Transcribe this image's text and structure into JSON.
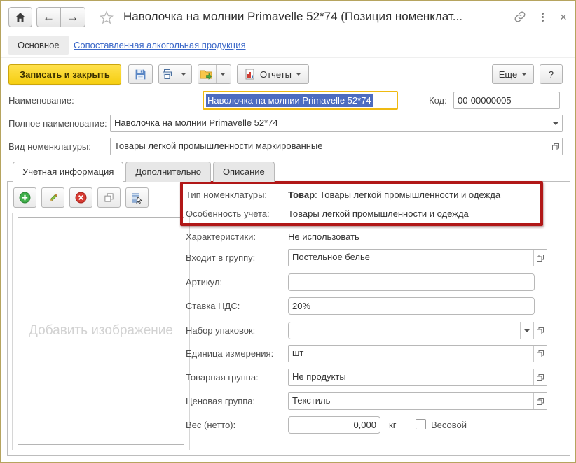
{
  "window": {
    "title": "Наволочка на молнии Primavelle 52*74 (Позиция номенклат...",
    "nav": {
      "main_tab": "Основное",
      "link_tab": "Сопоставленная алкогольная продукция"
    }
  },
  "toolbar": {
    "save_close_label": "Записать и закрыть",
    "reports_label": "Отчеты",
    "more_label": "Еще",
    "help_label": "?"
  },
  "header_fields": {
    "name_label": "Наименование:",
    "name_value": "Наволочка на молнии Primavelle 52*74",
    "code_label": "Код:",
    "code_value": "00-00000005",
    "full_name_label": "Полное наименование:",
    "full_name_value": "Наволочка на молнии Primavelle 52*74",
    "kind_label": "Вид номенклатуры:",
    "kind_value": "Товары легкой промышленности маркированные"
  },
  "tabs": {
    "t1": "Учетная информация",
    "t2": "Дополнительно",
    "t3": "Описание"
  },
  "image_panel": {
    "placeholder": "Добавить изображение"
  },
  "details": {
    "type_label": "Тип номенклатуры:",
    "type_value_bold": "Товар",
    "type_value_rest": ": Товары легкой промышленности и одежда",
    "accounting_label": "Особенность учета:",
    "accounting_value": "Товары легкой промышленности и одежда",
    "characteristics_label": "Характеристики:",
    "characteristics_value": "Не использовать",
    "group_label": "Входит в группу:",
    "group_value": "Постельное белье",
    "article_label": "Артикул:",
    "article_value": "",
    "vat_label": "Ставка НДС:",
    "vat_value": "20%",
    "packaging_label": "Набор упаковок:",
    "packaging_value": "",
    "unit_label": "Единица измерения:",
    "unit_value": "шт",
    "product_group_label": "Товарная группа:",
    "product_group_value": "Не продукты",
    "price_group_label": "Ценовая группа:",
    "price_group_value": "Текстиль",
    "weight_label": "Вес (нетто):",
    "weight_value": "0,000",
    "weight_unit": "кг",
    "weighted_label": "Весовой"
  },
  "icons": {
    "titlebar": [
      "home-icon",
      "back-icon",
      "forward-icon",
      "favorite-star-icon",
      "copy-link-icon",
      "more-kebab-icon",
      "close-icon"
    ],
    "command_bar": [
      "save-icon",
      "print-icon",
      "attach-folder-icon",
      "report-icon"
    ],
    "list_toolbar": [
      "add-icon",
      "edit-pencil-icon",
      "delete-icon",
      "copy-icon",
      "pick-from-list-icon"
    ],
    "field_buttons": [
      "dropdown-arrow-icon",
      "open-value-icon"
    ]
  },
  "colors": {
    "window_border": "#b6a45f",
    "primary_button": "#f8d41c",
    "focus_border": "#efba12",
    "selection_bg": "#4d6cc0",
    "link": "#3a67c8",
    "annotation_red": "#b11717"
  }
}
